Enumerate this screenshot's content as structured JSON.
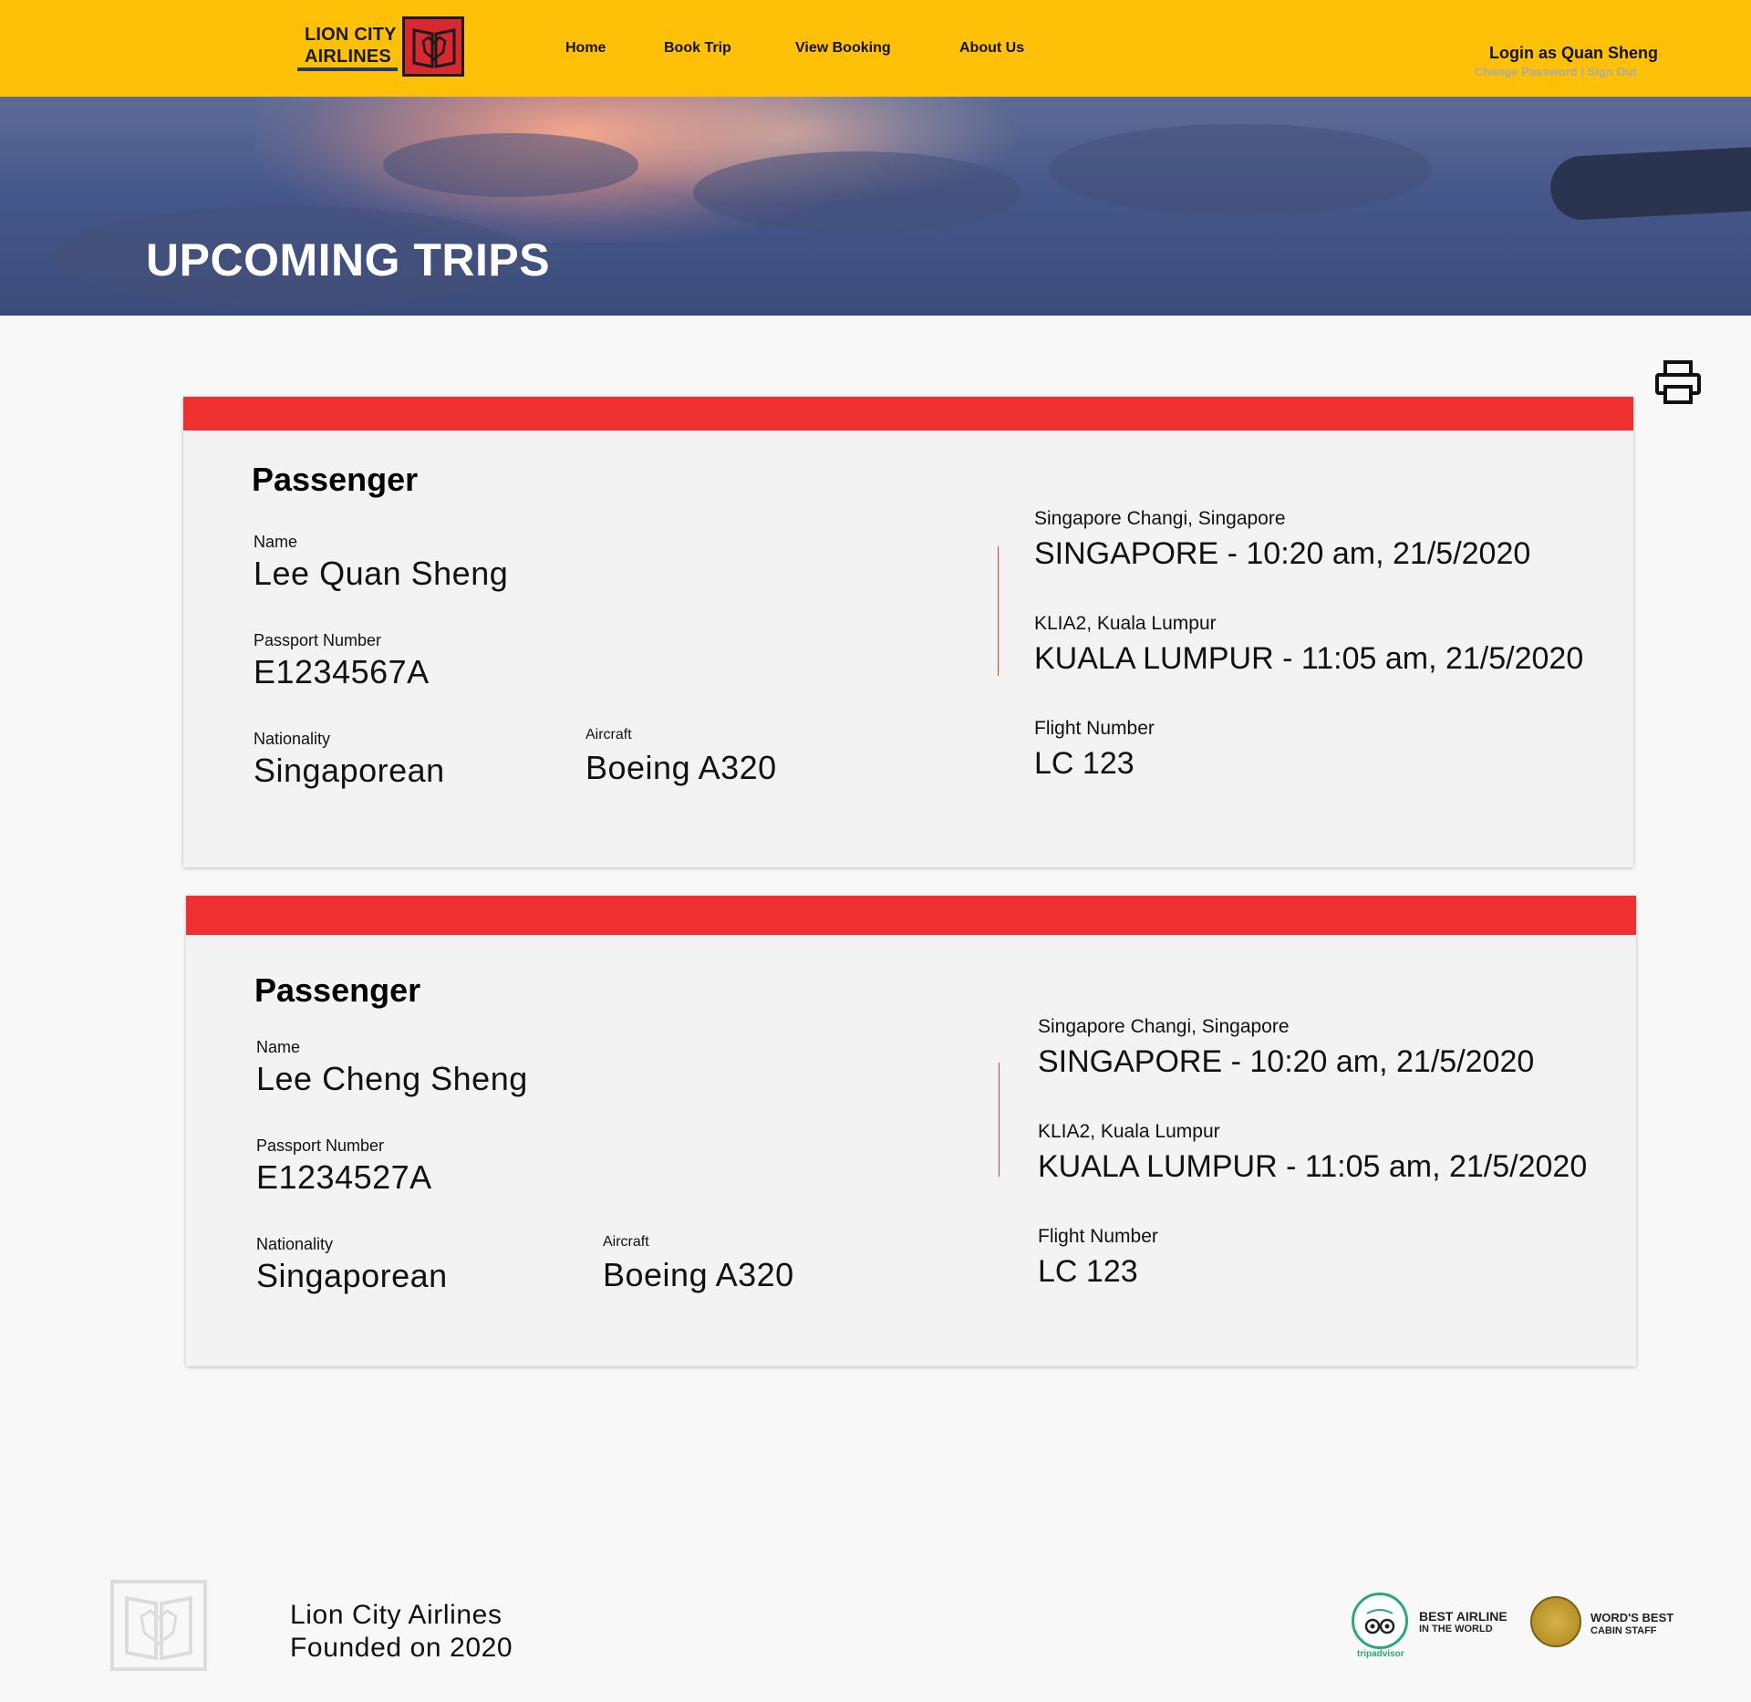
{
  "header": {
    "logo_text_line1": "LION CITY",
    "logo_text_line2": "AIRLINES",
    "nav": [
      "Home",
      "Book Trip",
      "View Booking",
      "About Us"
    ],
    "login": "Login as Quan Sheng",
    "change_password": "Change Password",
    "separator": "|",
    "sign_out": "Sign Out"
  },
  "hero": {
    "title": "UPCOMING TRIPS"
  },
  "trips": [
    {
      "heading": "Passenger",
      "name_label": "Name",
      "name": "Lee Quan Sheng",
      "passport_label": "Passport Number",
      "passport": "E1234567A",
      "nationality_label": "Nationality",
      "nationality": "Singaporean",
      "aircraft_label": "Aircraft",
      "aircraft": "Boeing A320",
      "origin_label": "Singapore Changi, Singapore",
      "origin": "SINGAPORE - 10:20 am, 21/5/2020",
      "destination_label": "KLIA2, Kuala Lumpur",
      "destination": "KUALA LUMPUR - 11:05 am, 21/5/2020",
      "flight_label": "Flight Number",
      "flight": "LC 123"
    },
    {
      "heading": "Passenger",
      "name_label": "Name",
      "name": "Lee Cheng Sheng",
      "passport_label": "Passport Number",
      "passport": "E1234527A",
      "nationality_label": "Nationality",
      "nationality": "Singaporean",
      "aircraft_label": "Aircraft",
      "aircraft": "Boeing A320",
      "origin_label": "Singapore Changi, Singapore",
      "origin": "SINGAPORE - 10:20 am, 21/5/2020",
      "destination_label": "KLIA2, Kuala Lumpur",
      "destination": "KUALA LUMPUR - 11:05 am, 21/5/2020",
      "flight_label": "Flight Number",
      "flight": "LC 123"
    }
  ],
  "footer": {
    "line1": "Lion City Airlines",
    "line2": "Founded on 2020",
    "awards": [
      {
        "title": "BEST AIRLINE",
        "subtitle": "IN THE WORLD",
        "badge_caption": "tripadvisor"
      },
      {
        "title": "WORD'S BEST",
        "subtitle": "CABIN STAFF"
      }
    ]
  },
  "colors": {
    "header": "#ffc107",
    "card_bar": "#ee3030",
    "logo_red": "#d9282f"
  },
  "icons": {
    "print": "printer-icon"
  }
}
